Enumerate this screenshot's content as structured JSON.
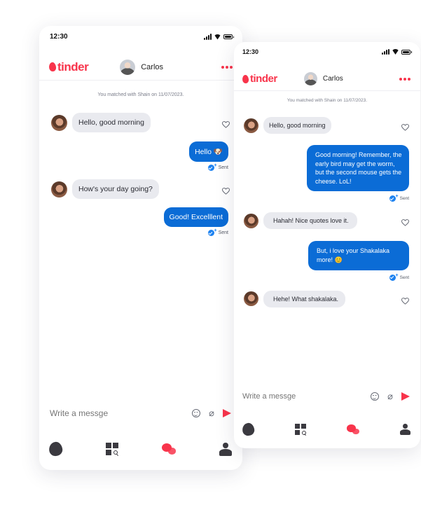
{
  "colors": {
    "brand": "#f8344b",
    "outgoing_bubble": "#0b6cd6",
    "incoming_bubble": "#e9eaef",
    "sent_check": "#1d82f0"
  },
  "screens": [
    {
      "status": {
        "time": "12:30"
      },
      "header": {
        "logo_text": "tinder",
        "contact_name": "Carlos"
      },
      "matched_text": "You matched with Shain on 11/07/2023.",
      "messages": [
        {
          "direction": "in",
          "text": "Hello, good morning"
        },
        {
          "direction": "out",
          "text": "Hello 🐶",
          "status": "Sent"
        },
        {
          "direction": "in",
          "text": "How's your day going?"
        },
        {
          "direction": "out",
          "text": "Good! Excelllent",
          "status": "Sent"
        }
      ],
      "composer": {
        "placeholder": "Write a messge"
      },
      "tabbar": {
        "icons": [
          "flame-icon",
          "explore-icon",
          "chat-icon",
          "profile-icon"
        ],
        "active": "chat-icon"
      }
    },
    {
      "status": {
        "time": "12:30"
      },
      "header": {
        "logo_text": "tinder",
        "contact_name": "Carlos"
      },
      "matched_text": "You matched with Shain on 11/07/2023.",
      "messages": [
        {
          "direction": "in",
          "text": "Hello, good morning"
        },
        {
          "direction": "out",
          "text": "Good morning! Remember, the early bird may get the worm, but the second mouse gets the cheese. LoL!",
          "status": "Sent"
        },
        {
          "direction": "in",
          "text": "Hahah! Nice quotes love it."
        },
        {
          "direction": "out",
          "text": "But, i love your Shakalaka more! 😊",
          "status": "Sent"
        },
        {
          "direction": "in",
          "text": "Hehe! What shakalaka."
        }
      ],
      "composer": {
        "placeholder": "Write a messge"
      },
      "tabbar": {
        "icons": [
          "flame-icon",
          "explore-icon",
          "chat-icon",
          "profile-icon"
        ],
        "active": "chat-icon"
      }
    }
  ]
}
